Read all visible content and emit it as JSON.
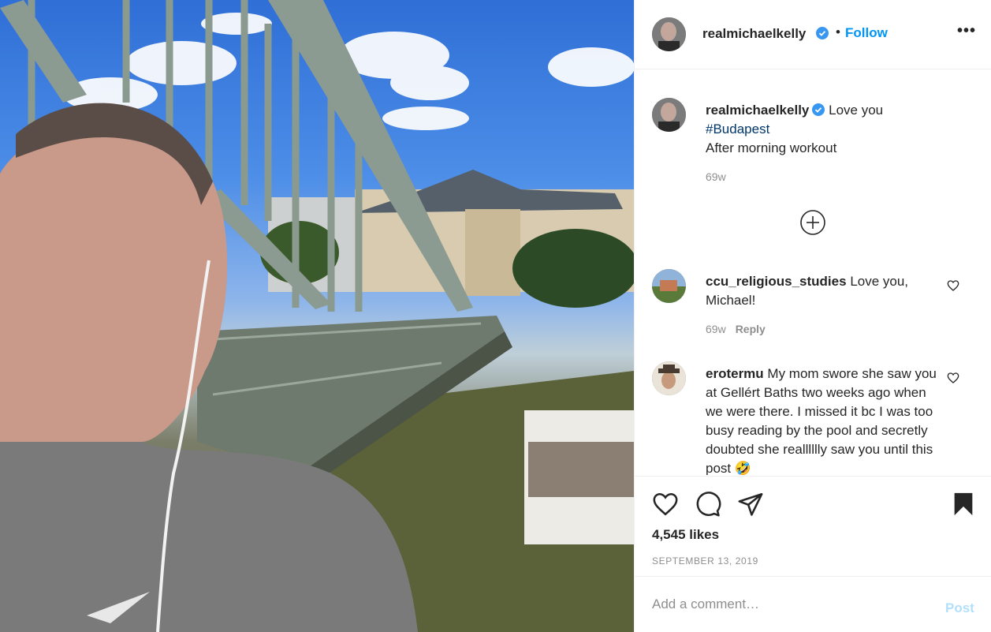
{
  "post": {
    "photo_icon": "photo",
    "author": {
      "username": "realmichaelkelly",
      "verified_icon": "verified-badge-icon",
      "follow_separator": "•",
      "follow_label": "Follow",
      "more_label": "•••"
    },
    "caption": {
      "username": "realmichaelkelly",
      "text": "Love you",
      "hashtag": "#Budapest",
      "line3": "After morning workout",
      "age": "69w"
    },
    "load_more_icon": "plus-circle-icon",
    "comments": [
      {
        "username": "ccu_religious_studies",
        "text": "Love you, Michael!",
        "age": "69w",
        "reply_label": "Reply"
      },
      {
        "username": "erotermu",
        "text": "My mom swore she saw you at Gellért Baths two weeks ago when we were there. I missed it bc I was too busy reading by the pool and secretly doubted she realllllly saw you until this post 🤣"
      }
    ],
    "likes": "4,545 likes",
    "date": "SEPTEMBER 13, 2019",
    "add_comment": {
      "placeholder": "Add a comment…",
      "post_label": "Post"
    },
    "colors": {
      "accent": "#0095f6",
      "hashtag": "#00376b",
      "muted": "#8e8e8e",
      "post_disabled": "#b2dffc"
    }
  }
}
